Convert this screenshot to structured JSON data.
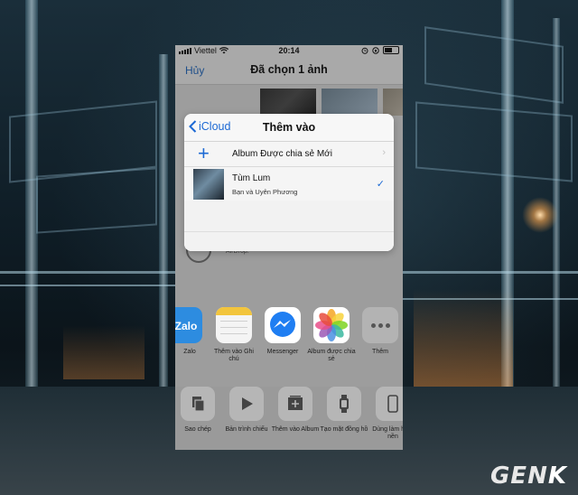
{
  "status_bar": {
    "carrier": "Viettel",
    "time": "20:14"
  },
  "nav_bar": {
    "cancel_label": "Hủy",
    "title": "Đã chọn 1 ảnh"
  },
  "popup": {
    "back_label": "iCloud",
    "title": "Thêm vào",
    "new_shared_album_label": "Album Được chia sẻ Mới",
    "albums": [
      {
        "name": "Tùm Lum",
        "members": "Bạn và Uyên Phương",
        "selected": true
      }
    ]
  },
  "airdrop_label": "AirDrop.",
  "share_apps": [
    {
      "label": "Zalo",
      "icon": "zalo-icon"
    },
    {
      "label": "Thêm vào Ghi chú",
      "icon": "notes-icon"
    },
    {
      "label": "Messenger",
      "icon": "messenger-icon"
    },
    {
      "label": "Album được chia sẻ",
      "icon": "photos-icon"
    },
    {
      "label": "Thêm",
      "icon": "more-icon"
    }
  ],
  "actions": [
    {
      "label": "Sao chép",
      "icon": "copy-icon"
    },
    {
      "label": "Bản trình chiếu",
      "icon": "play-icon"
    },
    {
      "label": "Thêm vào Album",
      "icon": "add-album-icon"
    },
    {
      "label": "Tạo mặt đồng hồ",
      "icon": "watch-icon"
    },
    {
      "label": "Dùng làm hình nền",
      "icon": "phone-icon"
    }
  ],
  "watermark": {
    "text_a": "GEN",
    "text_b": "K"
  },
  "colors": {
    "ios_blue": "#1c69d4",
    "sheet_background": "#f5f5f5",
    "dimmed_background": "#9d9d9d"
  }
}
